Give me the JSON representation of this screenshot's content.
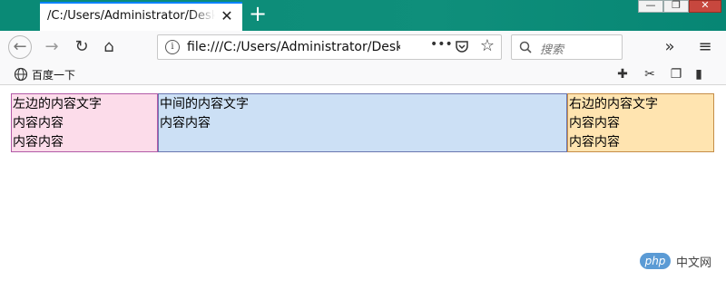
{
  "browser": {
    "tab_title": "/C:/Users/Administrator/Desktop",
    "tab_close": "✕",
    "new_tab": "+",
    "url": "file:///C:/Users/Administrator/Desk",
    "search_placeholder": "搜索",
    "bookmark_label": "百度一下",
    "win_minimize": "—",
    "win_maximize": "❐",
    "win_close": "✕"
  },
  "page": {
    "left": {
      "lines": [
        "左边的内容文字",
        "内容内容",
        "内容内容"
      ]
    },
    "middle": {
      "lines": [
        "中间的内容文字",
        "内容内容"
      ]
    },
    "right": {
      "lines": [
        "右边的内容文字",
        "内容内容",
        "内容内容"
      ]
    }
  },
  "watermark": {
    "logo": "php",
    "text": "中文网"
  },
  "colors": {
    "left_bg": "#fcdcea",
    "middle_bg": "#cce0f5",
    "right_bg": "#ffe4b0",
    "titlebar": "#0a8a76",
    "tab_accent": "#0a84ff"
  }
}
